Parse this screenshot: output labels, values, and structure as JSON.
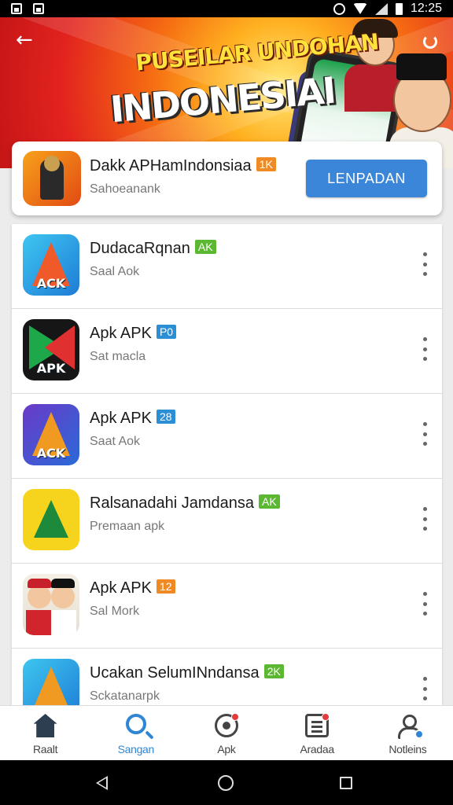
{
  "status_bar": {
    "time": "12:25"
  },
  "banner": {
    "title_line1": "PUSEILAR UNDOHAN",
    "title_line2": "INDONESIAI"
  },
  "featured": {
    "title": "Dakk APHamIndonsiaa",
    "badge": "1K",
    "badge_color": "#f08a24",
    "subtitle": "Sahoeanank",
    "button_label": "LENPADAN"
  },
  "apps": [
    {
      "name": "DudacaRqnan",
      "badge": "AK",
      "badge_color": "#5cb833",
      "subtitle": "Saal Aok",
      "icon_label": "ACK"
    },
    {
      "name": "Apk APK",
      "badge": "P0",
      "badge_color": "#2b8fd6",
      "subtitle": "Sat macla",
      "icon_label": "APK"
    },
    {
      "name": "Apk APK",
      "badge": "28",
      "badge_color": "#2b8fd6",
      "subtitle": "Saat Aok",
      "icon_label": "ACK"
    },
    {
      "name": "Ralsanadahi Jamdansa",
      "badge": "AK",
      "badge_color": "#5cb833",
      "subtitle": "Premaan apk",
      "icon_label": ""
    },
    {
      "name": "Apk APK",
      "badge": "12",
      "badge_color": "#f08a24",
      "subtitle": "Sal Mork",
      "icon_label": ""
    },
    {
      "name": "Ucakan SelumINndansa",
      "badge": "2K",
      "badge_color": "#5cb833",
      "subtitle": "Sckatanarpk",
      "icon_label": ""
    }
  ],
  "bottom_nav": [
    {
      "label": "Raalt",
      "icon": "home-icon"
    },
    {
      "label": "Sangan",
      "icon": "search-icon",
      "active": true
    },
    {
      "label": "Apk",
      "icon": "apk-icon"
    },
    {
      "label": "Aradaa",
      "icon": "document-icon"
    },
    {
      "label": "Notleins",
      "icon": "person-icon"
    }
  ],
  "colors": {
    "accent": "#3b86d8",
    "banner_red": "#e2231f",
    "banner_yellow": "#ffe23c"
  }
}
